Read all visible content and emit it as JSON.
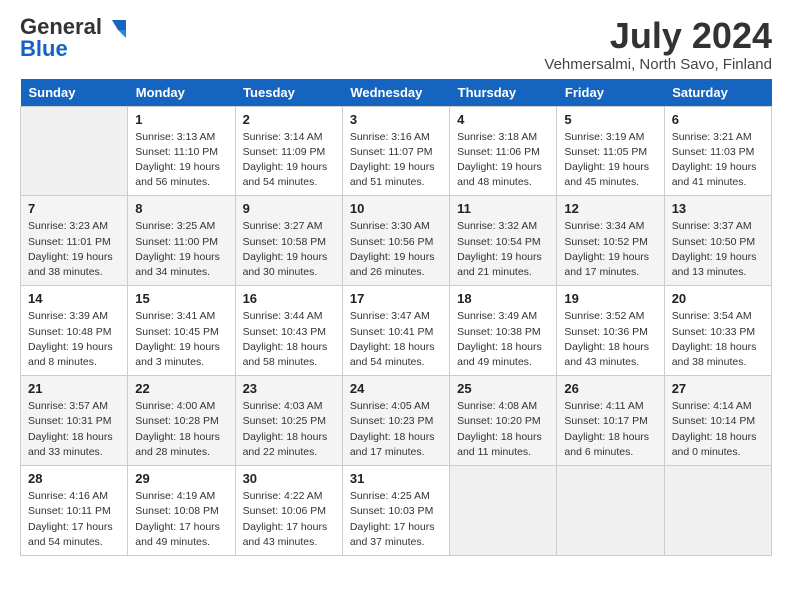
{
  "logo": {
    "general": "General",
    "blue": "Blue"
  },
  "title": "July 2024",
  "location": "Vehmersalmi, North Savo, Finland",
  "days_of_week": [
    "Sunday",
    "Monday",
    "Tuesday",
    "Wednesday",
    "Thursday",
    "Friday",
    "Saturday"
  ],
  "weeks": [
    [
      {
        "day": null
      },
      {
        "day": "1",
        "sunrise": "Sunrise: 3:13 AM",
        "sunset": "Sunset: 11:10 PM",
        "daylight": "Daylight: 19 hours and 56 minutes."
      },
      {
        "day": "2",
        "sunrise": "Sunrise: 3:14 AM",
        "sunset": "Sunset: 11:09 PM",
        "daylight": "Daylight: 19 hours and 54 minutes."
      },
      {
        "day": "3",
        "sunrise": "Sunrise: 3:16 AM",
        "sunset": "Sunset: 11:07 PM",
        "daylight": "Daylight: 19 hours and 51 minutes."
      },
      {
        "day": "4",
        "sunrise": "Sunrise: 3:18 AM",
        "sunset": "Sunset: 11:06 PM",
        "daylight": "Daylight: 19 hours and 48 minutes."
      },
      {
        "day": "5",
        "sunrise": "Sunrise: 3:19 AM",
        "sunset": "Sunset: 11:05 PM",
        "daylight": "Daylight: 19 hours and 45 minutes."
      },
      {
        "day": "6",
        "sunrise": "Sunrise: 3:21 AM",
        "sunset": "Sunset: 11:03 PM",
        "daylight": "Daylight: 19 hours and 41 minutes."
      }
    ],
    [
      {
        "day": "7",
        "sunrise": "Sunrise: 3:23 AM",
        "sunset": "Sunset: 11:01 PM",
        "daylight": "Daylight: 19 hours and 38 minutes."
      },
      {
        "day": "8",
        "sunrise": "Sunrise: 3:25 AM",
        "sunset": "Sunset: 11:00 PM",
        "daylight": "Daylight: 19 hours and 34 minutes."
      },
      {
        "day": "9",
        "sunrise": "Sunrise: 3:27 AM",
        "sunset": "Sunset: 10:58 PM",
        "daylight": "Daylight: 19 hours and 30 minutes."
      },
      {
        "day": "10",
        "sunrise": "Sunrise: 3:30 AM",
        "sunset": "Sunset: 10:56 PM",
        "daylight": "Daylight: 19 hours and 26 minutes."
      },
      {
        "day": "11",
        "sunrise": "Sunrise: 3:32 AM",
        "sunset": "Sunset: 10:54 PM",
        "daylight": "Daylight: 19 hours and 21 minutes."
      },
      {
        "day": "12",
        "sunrise": "Sunrise: 3:34 AM",
        "sunset": "Sunset: 10:52 PM",
        "daylight": "Daylight: 19 hours and 17 minutes."
      },
      {
        "day": "13",
        "sunrise": "Sunrise: 3:37 AM",
        "sunset": "Sunset: 10:50 PM",
        "daylight": "Daylight: 19 hours and 13 minutes."
      }
    ],
    [
      {
        "day": "14",
        "sunrise": "Sunrise: 3:39 AM",
        "sunset": "Sunset: 10:48 PM",
        "daylight": "Daylight: 19 hours and 8 minutes."
      },
      {
        "day": "15",
        "sunrise": "Sunrise: 3:41 AM",
        "sunset": "Sunset: 10:45 PM",
        "daylight": "Daylight: 19 hours and 3 minutes."
      },
      {
        "day": "16",
        "sunrise": "Sunrise: 3:44 AM",
        "sunset": "Sunset: 10:43 PM",
        "daylight": "Daylight: 18 hours and 58 minutes."
      },
      {
        "day": "17",
        "sunrise": "Sunrise: 3:47 AM",
        "sunset": "Sunset: 10:41 PM",
        "daylight": "Daylight: 18 hours and 54 minutes."
      },
      {
        "day": "18",
        "sunrise": "Sunrise: 3:49 AM",
        "sunset": "Sunset: 10:38 PM",
        "daylight": "Daylight: 18 hours and 49 minutes."
      },
      {
        "day": "19",
        "sunrise": "Sunrise: 3:52 AM",
        "sunset": "Sunset: 10:36 PM",
        "daylight": "Daylight: 18 hours and 43 minutes."
      },
      {
        "day": "20",
        "sunrise": "Sunrise: 3:54 AM",
        "sunset": "Sunset: 10:33 PM",
        "daylight": "Daylight: 18 hours and 38 minutes."
      }
    ],
    [
      {
        "day": "21",
        "sunrise": "Sunrise: 3:57 AM",
        "sunset": "Sunset: 10:31 PM",
        "daylight": "Daylight: 18 hours and 33 minutes."
      },
      {
        "day": "22",
        "sunrise": "Sunrise: 4:00 AM",
        "sunset": "Sunset: 10:28 PM",
        "daylight": "Daylight: 18 hours and 28 minutes."
      },
      {
        "day": "23",
        "sunrise": "Sunrise: 4:03 AM",
        "sunset": "Sunset: 10:25 PM",
        "daylight": "Daylight: 18 hours and 22 minutes."
      },
      {
        "day": "24",
        "sunrise": "Sunrise: 4:05 AM",
        "sunset": "Sunset: 10:23 PM",
        "daylight": "Daylight: 18 hours and 17 minutes."
      },
      {
        "day": "25",
        "sunrise": "Sunrise: 4:08 AM",
        "sunset": "Sunset: 10:20 PM",
        "daylight": "Daylight: 18 hours and 11 minutes."
      },
      {
        "day": "26",
        "sunrise": "Sunrise: 4:11 AM",
        "sunset": "Sunset: 10:17 PM",
        "daylight": "Daylight: 18 hours and 6 minutes."
      },
      {
        "day": "27",
        "sunrise": "Sunrise: 4:14 AM",
        "sunset": "Sunset: 10:14 PM",
        "daylight": "Daylight: 18 hours and 0 minutes."
      }
    ],
    [
      {
        "day": "28",
        "sunrise": "Sunrise: 4:16 AM",
        "sunset": "Sunset: 10:11 PM",
        "daylight": "Daylight: 17 hours and 54 minutes."
      },
      {
        "day": "29",
        "sunrise": "Sunrise: 4:19 AM",
        "sunset": "Sunset: 10:08 PM",
        "daylight": "Daylight: 17 hours and 49 minutes."
      },
      {
        "day": "30",
        "sunrise": "Sunrise: 4:22 AM",
        "sunset": "Sunset: 10:06 PM",
        "daylight": "Daylight: 17 hours and 43 minutes."
      },
      {
        "day": "31",
        "sunrise": "Sunrise: 4:25 AM",
        "sunset": "Sunset: 10:03 PM",
        "daylight": "Daylight: 17 hours and 37 minutes."
      },
      {
        "day": null
      },
      {
        "day": null
      },
      {
        "day": null
      }
    ]
  ]
}
